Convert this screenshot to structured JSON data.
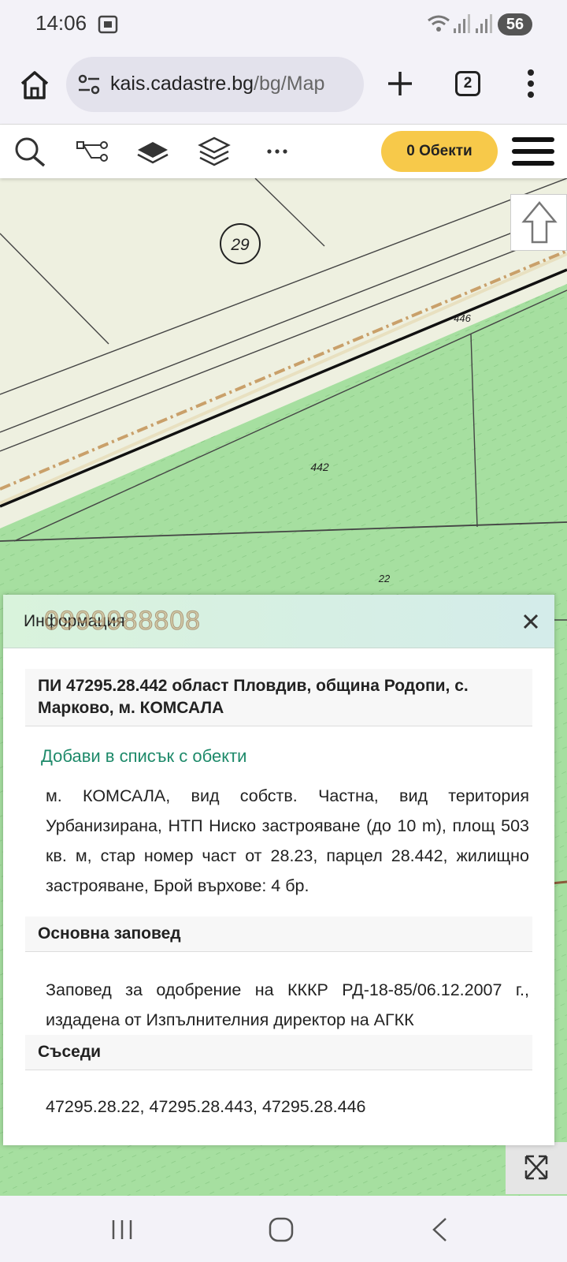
{
  "status_bar": {
    "time": "14:06",
    "battery": "56"
  },
  "browser": {
    "url_host": "kais.cadastre.bg",
    "url_path": "/bg/Map",
    "tab_count": "2"
  },
  "toolbar": {
    "objects_button": "0 Обекти"
  },
  "map": {
    "parcel_labels": [
      "29",
      "446",
      "442",
      "22"
    ],
    "colors": {
      "base": "#eef0e0",
      "green": "#a6dfa0"
    }
  },
  "panel": {
    "header": "Информация",
    "watermark": "0999988808",
    "parcel_title": "ПИ 47295.28.442 област Пловдив, община Родопи, с. Марково, м. КОМСАЛА",
    "add_link": "Добави в списък с обекти",
    "description": "м. КОМСАЛА, вид собств. Частна, вид територия Урбанизирана, НТП Ниско застрояване (до 10 m), площ 503 кв. м, стар номер част от 28.23, парцел 28.442, жилищно застрояване, Брой върхове: 4 бр.",
    "order_title": "Основна заповед",
    "order_text": "Заповед за одобрение на КККР РД-18-85/06.12.2007 г., издадена от Изпълнителния директор на АГКК",
    "neighbors_title": "Съседи",
    "neighbors_text": "47295.28.22, 47295.28.443, 47295.28.446"
  }
}
